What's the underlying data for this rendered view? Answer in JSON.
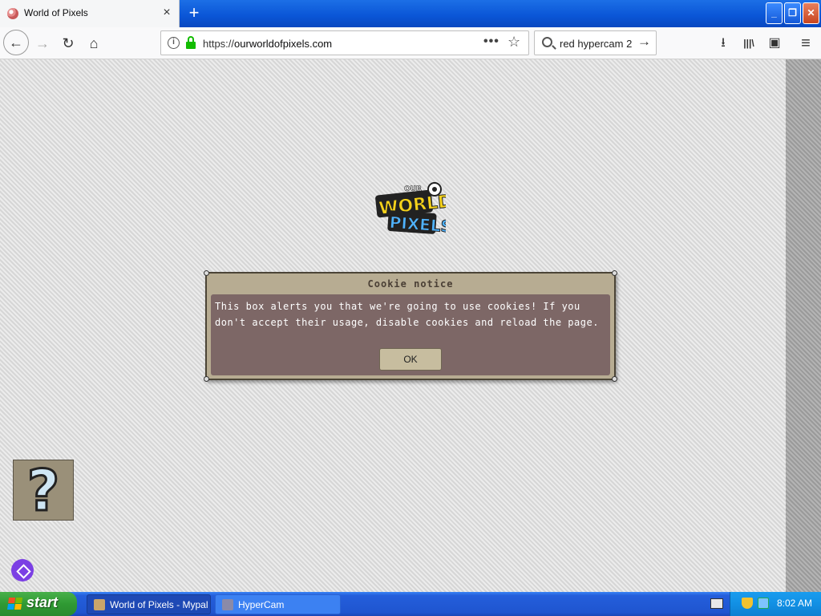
{
  "browser": {
    "tab": {
      "title": "World of Pixels",
      "close_icon": "×",
      "new_tab_icon": "+"
    },
    "window_controls": {
      "minimize": "_",
      "restore": "❐",
      "close": "✕"
    },
    "nav": {
      "back_icon": "←",
      "forward_icon": "→",
      "reload_icon": "↻",
      "home_icon": "⌂",
      "url_prefix": "https://",
      "url_domain": "ourworldofpixels.com",
      "page_actions_icon": "•••",
      "bookmark_icon": "☆",
      "search_text": "red hypercam 2",
      "search_go_icon": "→",
      "downloads_icon": "⭳",
      "library_icon": "|||\\",
      "sidebar_icon": "▣",
      "menu_icon": "≡"
    }
  },
  "page": {
    "dialog": {
      "title": "Cookie notice",
      "text": "This box alerts you that we're going to use cookies! If you don't accept their usage, disable cookies and reload the page.",
      "ok_label": "OK"
    },
    "help_glyph": "?",
    "colors": {
      "dialog_frame": "#b7ac92",
      "dialog_body": "#7d6766",
      "help_bg": "#9a9079",
      "fab": "#7b3fe4"
    }
  },
  "taskbar": {
    "start_label": "start",
    "items": [
      {
        "label": "World of Pixels - Mypal",
        "active": true
      },
      {
        "label": "HyperCam",
        "active": false
      }
    ],
    "clock": "8:02 AM"
  }
}
